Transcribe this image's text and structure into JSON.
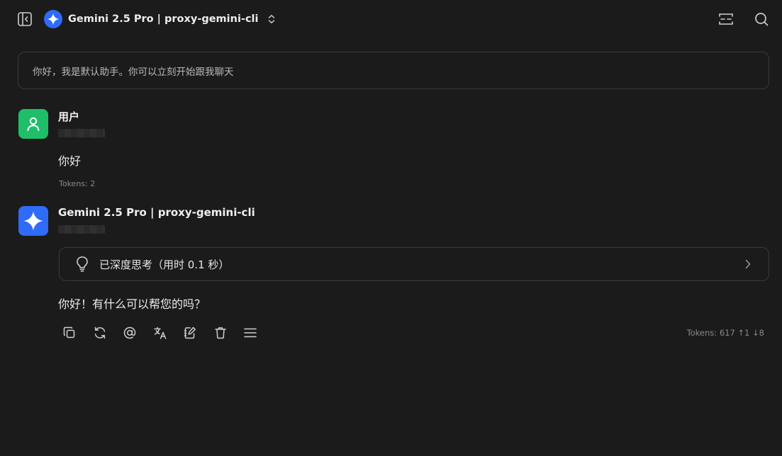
{
  "header": {
    "model_title": "Gemini 2.5 Pro | proxy-gemini-cli",
    "icons": {
      "sidebar_toggle": "sidebar-toggle-icon",
      "model_logo": "gemini-logo-icon",
      "model_dropdown": "chevron-updown-icon",
      "expand": "expand-icon",
      "search": "search-icon"
    }
  },
  "system_prompt": {
    "text": "你好，我是默认助手。你可以立刻开始跟我聊天"
  },
  "messages": {
    "user": {
      "name": "用户",
      "text": "你好",
      "tokens": "Tokens: 2",
      "avatar_color": "#1fbf6a"
    },
    "assistant": {
      "name": "Gemini 2.5 Pro | proxy-gemini-cli",
      "thinking_label": "已深度思考（用时 0.1 秒）",
      "text": "你好！有什么可以帮您的吗？",
      "tokens": "Tokens: 617 ↑1 ↓8",
      "avatar_color": "#2f6bf6",
      "actions": [
        "copy-icon",
        "regenerate-icon",
        "mention-icon",
        "translate-icon",
        "edit-icon",
        "delete-icon",
        "menu-icon"
      ]
    }
  },
  "colors": {
    "background": "#1b1b1b",
    "border": "#3a3a3a",
    "accent_blue": "#2f6bf6",
    "accent_green": "#1fbf6a"
  }
}
